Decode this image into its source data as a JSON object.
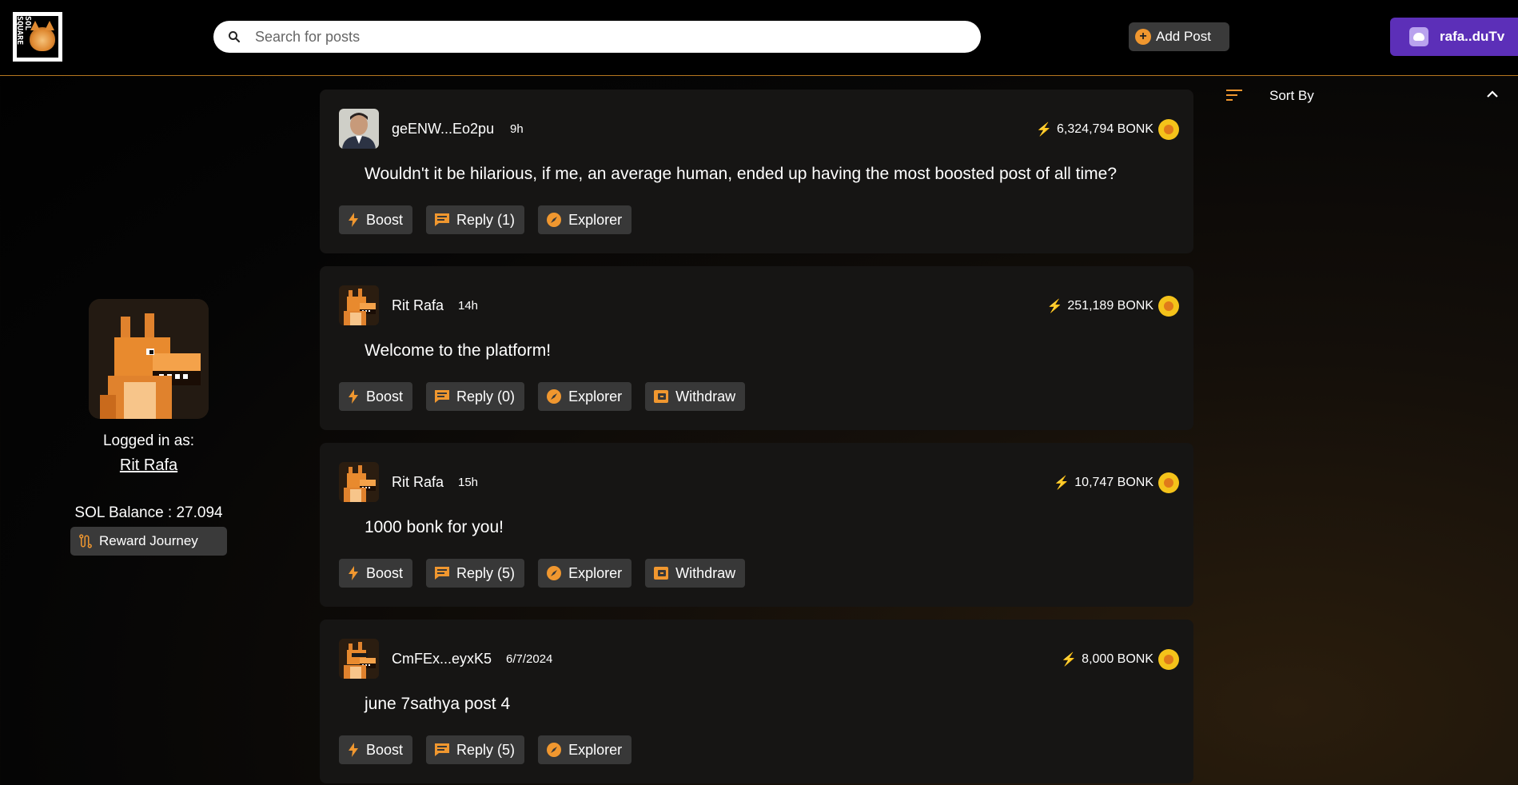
{
  "header": {
    "logo_text": "SOL SQUARE",
    "search_placeholder": "Search for posts",
    "add_post_label": "Add Post",
    "wallet_label": "rafa..duTv"
  },
  "profile": {
    "logged_in_label": "Logged in as:",
    "username": "Rit Rafa",
    "sol_balance": "SOL Balance : 27.094",
    "reward_label": "Reward Journey"
  },
  "sort": {
    "label": "Sort By"
  },
  "posts": [
    {
      "author": "geENW...Eo2pu",
      "time": "9h",
      "bonk": "6,324,794 BONK",
      "body": "Wouldn't it be hilarious, if me, an average human, ended up having the most boosted post of all time?",
      "boost": "Boost",
      "reply": "Reply (1)",
      "explorer": "Explorer"
    },
    {
      "author": "Rit Rafa",
      "time": "14h",
      "bonk": "251,189 BONK",
      "body": "Welcome to the platform!",
      "boost": "Boost",
      "reply": "Reply (0)",
      "explorer": "Explorer",
      "withdraw": "Withdraw"
    },
    {
      "author": "Rit Rafa",
      "time": "15h",
      "bonk": "10,747 BONK",
      "body": "1000 bonk for you!",
      "boost": "Boost",
      "reply": "Reply (5)",
      "explorer": "Explorer",
      "withdraw": "Withdraw"
    },
    {
      "author": "CmFEx...eyxK5",
      "time": "6/7/2024",
      "bonk": "8,000 BONK",
      "body": "june 7sathya post 4",
      "boost": "Boost",
      "reply": "Reply (5)",
      "explorer": "Explorer"
    }
  ],
  "colors": {
    "accent": "#f0972f",
    "wallet": "#5c2fb8",
    "card": "#161514",
    "button": "#383838"
  }
}
